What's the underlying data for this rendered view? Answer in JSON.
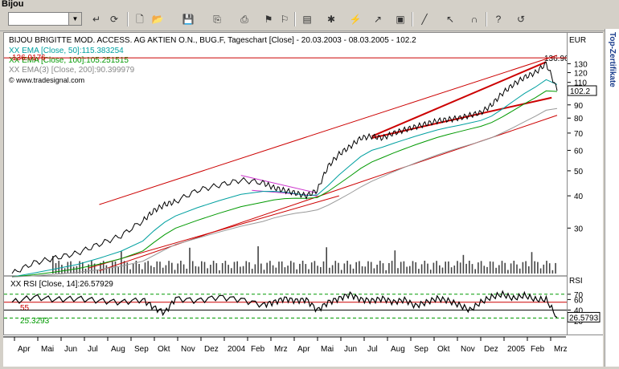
{
  "window": {
    "title": "Bijou"
  },
  "side_tab": {
    "label": "Top-Zertifikate"
  },
  "chart_data": {
    "type": "line",
    "title": "BIJOU BRIGITTE MOD. ACCESS. AG AKTIEN O.N., BUG.F, Tageschart [Close] - 20.03.2003 - 08.03.2005 - 102.2",
    "currency": "EUR",
    "watermark": "www.tradesignal.com",
    "legend": [
      {
        "text": "XX EMA [Close, 50]:115.383254",
        "color": "#00a0a0"
      },
      {
        "text": "XX EMA [Close, 100]:105.251515",
        "color": "#009900"
      },
      {
        "text": "XX EMA(3) [Close, 200]:90.399979",
        "color": "#888888"
      }
    ],
    "price_axis": {
      "scale": "log",
      "ticks": [
        30,
        40,
        50,
        60,
        70,
        80,
        90,
        110,
        120,
        130
      ]
    },
    "last_price": "102.2",
    "high_label": "136.96",
    "resistance_label": "136.9176",
    "months": [
      "Apr",
      "Mai",
      "Jun",
      "Jul",
      "Aug",
      "Sep",
      "Okt",
      "Nov",
      "Dez",
      "2004",
      "Feb",
      "Mrz",
      "Apr",
      "Mai",
      "Jun",
      "Jul",
      "Aug",
      "Sep",
      "Okt",
      "Nov",
      "Dez",
      "2005",
      "Feb",
      "Mrz"
    ],
    "series": [
      {
        "name": "Close",
        "color": "#000000",
        "x": [
          0,
          4,
          8,
          12,
          16,
          20,
          24,
          26,
          28,
          30,
          34,
          38,
          42,
          46,
          48,
          50,
          52,
          54,
          56,
          58,
          60,
          62,
          64,
          66,
          68,
          70,
          72,
          74,
          76,
          78,
          80,
          82,
          84,
          86,
          88,
          90,
          92,
          94,
          96,
          98,
          100
        ],
        "y": [
          20,
          22,
          23,
          24,
          26,
          28,
          32,
          35,
          37,
          38,
          42,
          44,
          46,
          45,
          43,
          42,
          41,
          40,
          42,
          52,
          58,
          62,
          67,
          68,
          67,
          70,
          72,
          74,
          76,
          78,
          79,
          80,
          82,
          84,
          90,
          100,
          108,
          115,
          120,
          130,
          102.2
        ]
      }
    ],
    "rsi": {
      "label": "XX RSI [Close, 14]:26.57929",
      "axis_label": "RSI",
      "ticks": [
        20,
        40,
        60,
        70
      ],
      "level_labels": [
        "70",
        "55",
        "25.3293"
      ],
      "last_value": "26.5793",
      "values": [
        55,
        65,
        60,
        62,
        58,
        55,
        60,
        45,
        35,
        62,
        58,
        65,
        60,
        50,
        55,
        62,
        58,
        60,
        40,
        55,
        62,
        70,
        60,
        58,
        62,
        55,
        60,
        48,
        55,
        62,
        58,
        50,
        40,
        55,
        65,
        70,
        62,
        68,
        60,
        60,
        26.6
      ]
    }
  }
}
